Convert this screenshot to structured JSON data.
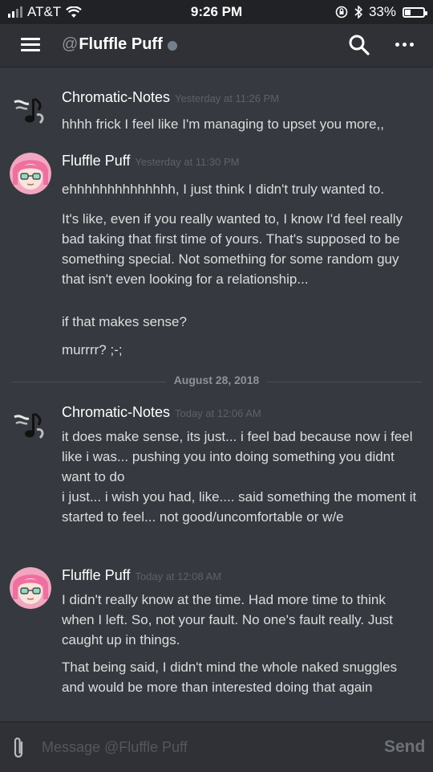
{
  "status_bar": {
    "carrier": "AT&T",
    "time": "9:26 PM",
    "battery": "33%",
    "battery_level": 0.33,
    "icons": [
      "signal-icon",
      "wifi-icon",
      "orientation-lock-icon",
      "bluetooth-icon",
      "battery-icon"
    ]
  },
  "header": {
    "at_symbol": "@",
    "title": "Fluffle Puff",
    "icons": [
      "menu-icon",
      "search-icon",
      "more-icon"
    ]
  },
  "messages": [
    {
      "author": "Chromatic-Notes",
      "timestamp": "Yesterday at 11:26 PM",
      "avatar": "music-note-avatar",
      "lines": [
        "hhhh frick I feel like I'm managing to upset you more,,"
      ]
    },
    {
      "author": "Fluffle Puff",
      "timestamp": "Yesterday at 11:30 PM",
      "avatar": "pink-hair-avatar",
      "lines": [
        "ehhhhhhhhhhhhhh, I just think I didn't truly wanted to.",
        "It's like, even if you really wanted to, I know I'd feel really bad taking that first time of yours. That's supposed to be something special. Not something for some random guy that isn't even looking for a relationship...",
        "if that makes sense?",
        "murrrr? ;-;"
      ]
    },
    {
      "author": "Chromatic-Notes",
      "timestamp": "Today at 12:06 AM",
      "avatar": "music-note-avatar",
      "lines": [
        "it does make sense, its just... i feel bad because now i feel like i was... pushing you into doing something you didnt want to do\ni just... i wish you had, like.... said something the moment it started to feel... not good/uncomfortable or w/e"
      ]
    },
    {
      "author": "Fluffle Puff",
      "timestamp": "Today at 12:08 AM",
      "avatar": "pink-hair-avatar",
      "lines": [
        "I didn't really know at the time. Had more time to think when I left. So, not your fault. No one's fault really. Just caught up in things.",
        "That being said, I didn't mind the whole naked snuggles and would be more than interested doing that again"
      ]
    }
  ],
  "date_divider": "August 28, 2018",
  "composer": {
    "placeholder": "Message @Fluffle Puff",
    "send_label": "Send"
  },
  "colors": {
    "background": "#36393f",
    "header": "#2f3136",
    "text": "#dcddde",
    "muted": "#5e6168"
  }
}
